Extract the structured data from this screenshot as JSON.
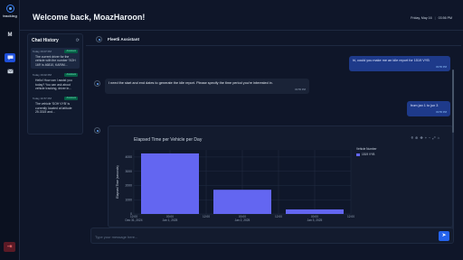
{
  "app": {
    "logo_text": "tracking"
  },
  "rail": {
    "avatar_letter": "M",
    "logout_icon": "logout-icon"
  },
  "header": {
    "welcome": "Welcome back, MoazHaroon!",
    "date": "Friday, May 16",
    "time": "03:56 PM"
  },
  "history": {
    "title": "Chat History",
    "items": [
      {
        "date": "Today, 03:07 PM",
        "badge": "Assistant",
        "snippet": "The current driver for the vehicle with the number 'SOH 169' is 46810, KARIM..."
      },
      {
        "date": "Today, 03:02 PM",
        "badge": "Assistant",
        "snippet": "Hello! How can I assist you today? You can ask about vehicle tracking, driver in..."
      },
      {
        "date": "Today, 02:57 PM",
        "badge": "Assistant",
        "snippet": "The vehicle 'SOH VYB' is currently located at latitude 25.3315 and..."
      }
    ]
  },
  "chat": {
    "assistant_name": "Fleetli Assistant",
    "messages": [
      {
        "role": "user",
        "text": "hi, could you make me an idle report for 1519 VYB",
        "time": "03:55 PM"
      },
      {
        "role": "bot",
        "text": "I need the start and end dates to generate the idle report. Please specify the time period you're interested in.",
        "time": "03:55 PM"
      },
      {
        "role": "user",
        "text": "from jan 1 to jun 3",
        "time": "03:55 PM"
      }
    ],
    "input_placeholder": "Type your message here..."
  },
  "chart_data": {
    "type": "bar",
    "title": "Elapsed Time per Vehicle per Day",
    "ylabel": "Elapsed Time (seconds)",
    "xlabel": "",
    "ylim": [
      0,
      4500
    ],
    "yticks": [
      0,
      1000,
      2000,
      3000,
      4000
    ],
    "x_tick_labels": [
      {
        "line1": "12:00",
        "line2": "Dec 31, 2024"
      },
      {
        "line1": "00:00",
        "line2": "Jan 1, 2025"
      },
      {
        "line1": "12:00",
        "line2": ""
      },
      {
        "line1": "00:00",
        "line2": "Jan 2, 2025"
      },
      {
        "line1": "12:00",
        "line2": ""
      },
      {
        "line1": "00:00",
        "line2": "Jan 3, 2025"
      },
      {
        "line1": "12:00",
        "line2": ""
      }
    ],
    "legend_title": "Vehicle Number",
    "series": [
      {
        "name": "1519 VYB",
        "color": "#6366f1",
        "points": [
          {
            "x": "2025-01-01",
            "y": 4250
          },
          {
            "x": "2025-01-02",
            "y": 1700
          },
          {
            "x": "2025-01-03",
            "y": 320
          }
        ]
      }
    ],
    "grid": true,
    "legend_position": "right"
  }
}
